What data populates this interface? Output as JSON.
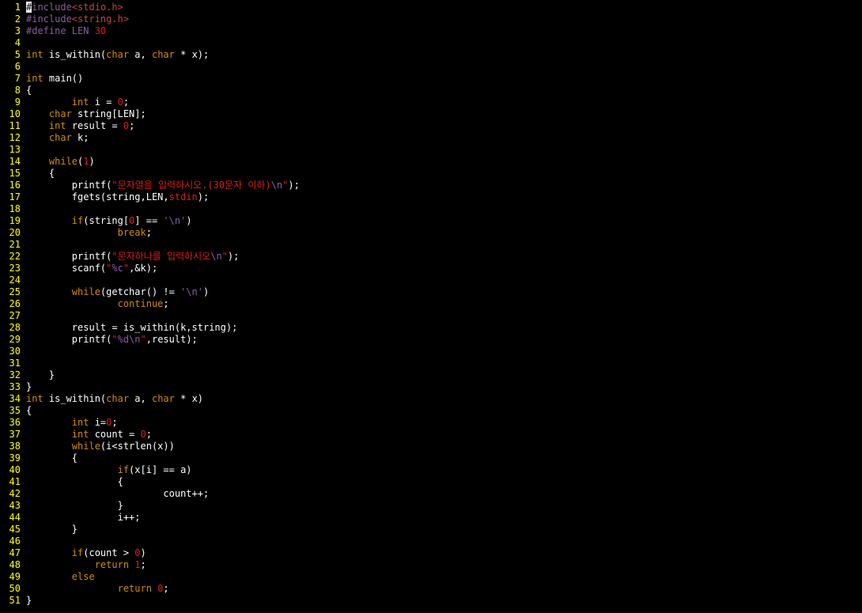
{
  "editor": {
    "colors": {
      "background": "#000000",
      "line_number": "#ffff00",
      "keyword": "#d18b00",
      "preprocessor": "#8a5aa3",
      "string": "#e01b1b",
      "number": "#e01b1b",
      "escape": "#8a5aa3",
      "text": "#ffffff"
    },
    "lines": [
      {
        "n": "1",
        "tokens": [
          [
            "cursor",
            "#"
          ],
          [
            "pre",
            "include"
          ],
          [
            "inc",
            "<stdio.h>"
          ]
        ]
      },
      {
        "n": "2",
        "tokens": [
          [
            "pre",
            "#include"
          ],
          [
            "inc",
            "<string.h>"
          ]
        ]
      },
      {
        "n": "3",
        "tokens": [
          [
            "pre",
            "#define LEN "
          ],
          [
            "num",
            "30"
          ]
        ]
      },
      {
        "n": "4",
        "tokens": []
      },
      {
        "n": "5",
        "tokens": [
          [
            "kw",
            "int"
          ],
          [
            "id",
            " is_within("
          ],
          [
            "kw",
            "char"
          ],
          [
            "id",
            " a, "
          ],
          [
            "kw",
            "char"
          ],
          [
            "id",
            " * x);"
          ]
        ]
      },
      {
        "n": "6",
        "tokens": []
      },
      {
        "n": "7",
        "tokens": [
          [
            "kw",
            "int"
          ],
          [
            "id",
            " main()"
          ]
        ]
      },
      {
        "n": "8",
        "tokens": [
          [
            "id",
            "{"
          ]
        ]
      },
      {
        "n": "9",
        "tokens": [
          [
            "id",
            "        "
          ],
          [
            "kw",
            "int"
          ],
          [
            "id",
            " i = "
          ],
          [
            "num",
            "0"
          ],
          [
            "id",
            ";"
          ]
        ]
      },
      {
        "n": "10",
        "tokens": [
          [
            "id",
            "    "
          ],
          [
            "kw",
            "char"
          ],
          [
            "id",
            " string[LEN];"
          ]
        ]
      },
      {
        "n": "11",
        "tokens": [
          [
            "id",
            "    "
          ],
          [
            "kw",
            "int"
          ],
          [
            "id",
            " result = "
          ],
          [
            "num",
            "0"
          ],
          [
            "id",
            ";"
          ]
        ]
      },
      {
        "n": "12",
        "tokens": [
          [
            "id",
            "    "
          ],
          [
            "kw",
            "char"
          ],
          [
            "id",
            " k;"
          ]
        ]
      },
      {
        "n": "13",
        "tokens": []
      },
      {
        "n": "14",
        "tokens": [
          [
            "id",
            "    "
          ],
          [
            "kw",
            "while"
          ],
          [
            "id",
            "("
          ],
          [
            "num",
            "1"
          ],
          [
            "id",
            ")"
          ]
        ]
      },
      {
        "n": "15",
        "tokens": [
          [
            "id",
            "    {"
          ]
        ]
      },
      {
        "n": "16",
        "tokens": [
          [
            "id",
            "        printf("
          ],
          [
            "str",
            "\"문자열을 입력하시오.(30문자 이하)"
          ],
          [
            "esc",
            "\\n"
          ],
          [
            "str",
            "\""
          ],
          [
            "id",
            ");"
          ]
        ]
      },
      {
        "n": "17",
        "tokens": [
          [
            "id",
            "        fgets(string,LEN,"
          ],
          [
            "str",
            "stdin"
          ],
          [
            "id",
            ");"
          ]
        ]
      },
      {
        "n": "18",
        "tokens": []
      },
      {
        "n": "19",
        "tokens": [
          [
            "id",
            "        "
          ],
          [
            "kw",
            "if"
          ],
          [
            "id",
            "(string["
          ],
          [
            "num",
            "0"
          ],
          [
            "id",
            "] == "
          ],
          [
            "chr",
            "'\\n'"
          ],
          [
            "id",
            ")"
          ]
        ]
      },
      {
        "n": "20",
        "tokens": [
          [
            "id",
            "                "
          ],
          [
            "kw",
            "break"
          ],
          [
            "id",
            ";"
          ]
        ]
      },
      {
        "n": "21",
        "tokens": []
      },
      {
        "n": "22",
        "tokens": [
          [
            "id",
            "        printf("
          ],
          [
            "str",
            "\"문자하나를 입력하시오"
          ],
          [
            "esc",
            "\\n"
          ],
          [
            "str",
            "\""
          ],
          [
            "id",
            ");"
          ]
        ]
      },
      {
        "n": "23",
        "tokens": [
          [
            "id",
            "        scanf("
          ],
          [
            "str",
            "\""
          ],
          [
            "esc",
            "%c"
          ],
          [
            "str",
            "\""
          ],
          [
            "id",
            ",&k);"
          ]
        ]
      },
      {
        "n": "24",
        "tokens": []
      },
      {
        "n": "25",
        "tokens": [
          [
            "id",
            "        "
          ],
          [
            "kw",
            "while"
          ],
          [
            "id",
            "(getchar() != "
          ],
          [
            "chr",
            "'\\n'"
          ],
          [
            "id",
            ")"
          ]
        ]
      },
      {
        "n": "26",
        "tokens": [
          [
            "id",
            "                "
          ],
          [
            "kw",
            "continue"
          ],
          [
            "id",
            ";"
          ]
        ]
      },
      {
        "n": "27",
        "tokens": []
      },
      {
        "n": "28",
        "tokens": [
          [
            "id",
            "        result = is_within(k,string);"
          ]
        ]
      },
      {
        "n": "29",
        "tokens": [
          [
            "id",
            "        printf("
          ],
          [
            "str",
            "\""
          ],
          [
            "esc",
            "%d\\n"
          ],
          [
            "str",
            "\""
          ],
          [
            "id",
            ",result);"
          ]
        ]
      },
      {
        "n": "30",
        "tokens": []
      },
      {
        "n": "31",
        "tokens": []
      },
      {
        "n": "32",
        "tokens": [
          [
            "id",
            "    }"
          ]
        ]
      },
      {
        "n": "33",
        "tokens": [
          [
            "id",
            "}"
          ]
        ]
      },
      {
        "n": "34",
        "tokens": [
          [
            "kw",
            "int"
          ],
          [
            "id",
            " is_within("
          ],
          [
            "kw",
            "char"
          ],
          [
            "id",
            " a, "
          ],
          [
            "kw",
            "char"
          ],
          [
            "id",
            " * x)"
          ]
        ]
      },
      {
        "n": "35",
        "tokens": [
          [
            "id",
            "{"
          ]
        ]
      },
      {
        "n": "36",
        "tokens": [
          [
            "id",
            "        "
          ],
          [
            "kw",
            "int"
          ],
          [
            "id",
            " i="
          ],
          [
            "num",
            "0"
          ],
          [
            "id",
            ";"
          ]
        ]
      },
      {
        "n": "37",
        "tokens": [
          [
            "id",
            "        "
          ],
          [
            "kw",
            "int"
          ],
          [
            "id",
            " count = "
          ],
          [
            "num",
            "0"
          ],
          [
            "id",
            ";"
          ]
        ]
      },
      {
        "n": "38",
        "tokens": [
          [
            "id",
            "        "
          ],
          [
            "kw",
            "while"
          ],
          [
            "id",
            "(i<strlen(x))"
          ]
        ]
      },
      {
        "n": "39",
        "tokens": [
          [
            "id",
            "        {"
          ]
        ]
      },
      {
        "n": "40",
        "tokens": [
          [
            "id",
            "                "
          ],
          [
            "kw",
            "if"
          ],
          [
            "id",
            "(x[i] == a)"
          ]
        ]
      },
      {
        "n": "41",
        "tokens": [
          [
            "id",
            "                {"
          ]
        ]
      },
      {
        "n": "42",
        "tokens": [
          [
            "id",
            "                        count++;"
          ]
        ]
      },
      {
        "n": "43",
        "tokens": [
          [
            "id",
            "                }"
          ]
        ]
      },
      {
        "n": "44",
        "tokens": [
          [
            "id",
            "                i++;"
          ]
        ]
      },
      {
        "n": "45",
        "tokens": [
          [
            "id",
            "        }"
          ]
        ]
      },
      {
        "n": "46",
        "tokens": []
      },
      {
        "n": "47",
        "tokens": [
          [
            "id",
            "        "
          ],
          [
            "kw",
            "if"
          ],
          [
            "id",
            "(count > "
          ],
          [
            "num",
            "0"
          ],
          [
            "id",
            ")"
          ]
        ]
      },
      {
        "n": "48",
        "tokens": [
          [
            "id",
            "            "
          ],
          [
            "kw",
            "return"
          ],
          [
            "id",
            " "
          ],
          [
            "num",
            "1"
          ],
          [
            "id",
            ";"
          ]
        ]
      },
      {
        "n": "49",
        "tokens": [
          [
            "id",
            "        "
          ],
          [
            "kw",
            "else"
          ]
        ]
      },
      {
        "n": "50",
        "tokens": [
          [
            "id",
            "                "
          ],
          [
            "kw",
            "return"
          ],
          [
            "id",
            " "
          ],
          [
            "num",
            "0"
          ],
          [
            "id",
            ";"
          ]
        ]
      },
      {
        "n": "51",
        "tokens": [
          [
            "id",
            "}"
          ]
        ]
      }
    ]
  }
}
